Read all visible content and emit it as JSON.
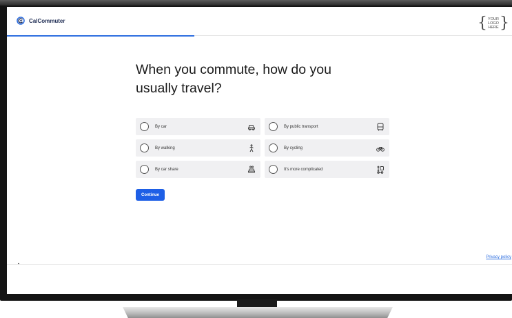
{
  "header": {
    "brand_name": "CalCommuter",
    "logo_placeholder": "YOUR\nLOGO\nHERE",
    "accent_color": "#2f6fe0"
  },
  "question": {
    "title": "When you commute, how do you usually travel?"
  },
  "options": [
    {
      "label": "By car",
      "icon": "car-icon"
    },
    {
      "label": "By public transport",
      "icon": "bus-icon"
    },
    {
      "label": "By walking",
      "icon": "walking-icon"
    },
    {
      "label": "By cycling",
      "icon": "bicycle-icon"
    },
    {
      "label": "By car share",
      "icon": "car-share-icon"
    },
    {
      "label": "It's more complicated",
      "icon": "mixed-transport-icon"
    }
  ],
  "actions": {
    "continue_label": "Continue",
    "button_color": "#1e5fe6"
  },
  "footer": {
    "privacy_label": "Privacy policy"
  }
}
